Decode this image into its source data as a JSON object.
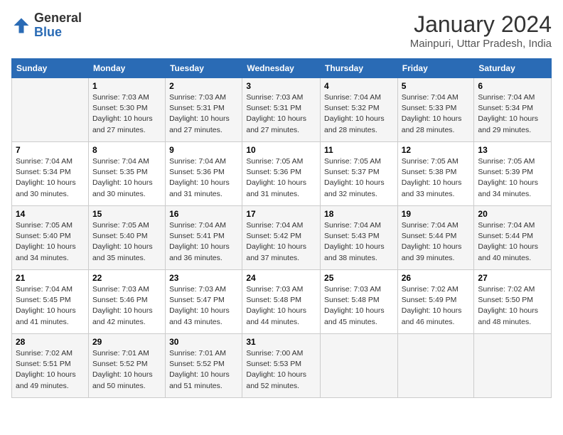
{
  "header": {
    "logo_general": "General",
    "logo_blue": "Blue",
    "month_year": "January 2024",
    "location": "Mainpuri, Uttar Pradesh, India"
  },
  "days_of_week": [
    "Sunday",
    "Monday",
    "Tuesday",
    "Wednesday",
    "Thursday",
    "Friday",
    "Saturday"
  ],
  "weeks": [
    [
      {
        "day": "",
        "info": ""
      },
      {
        "day": "1",
        "info": "Sunrise: 7:03 AM\nSunset: 5:30 PM\nDaylight: 10 hours\nand 27 minutes."
      },
      {
        "day": "2",
        "info": "Sunrise: 7:03 AM\nSunset: 5:31 PM\nDaylight: 10 hours\nand 27 minutes."
      },
      {
        "day": "3",
        "info": "Sunrise: 7:03 AM\nSunset: 5:31 PM\nDaylight: 10 hours\nand 27 minutes."
      },
      {
        "day": "4",
        "info": "Sunrise: 7:04 AM\nSunset: 5:32 PM\nDaylight: 10 hours\nand 28 minutes."
      },
      {
        "day": "5",
        "info": "Sunrise: 7:04 AM\nSunset: 5:33 PM\nDaylight: 10 hours\nand 28 minutes."
      },
      {
        "day": "6",
        "info": "Sunrise: 7:04 AM\nSunset: 5:34 PM\nDaylight: 10 hours\nand 29 minutes."
      }
    ],
    [
      {
        "day": "7",
        "info": "Sunrise: 7:04 AM\nSunset: 5:34 PM\nDaylight: 10 hours\nand 30 minutes."
      },
      {
        "day": "8",
        "info": "Sunrise: 7:04 AM\nSunset: 5:35 PM\nDaylight: 10 hours\nand 30 minutes."
      },
      {
        "day": "9",
        "info": "Sunrise: 7:04 AM\nSunset: 5:36 PM\nDaylight: 10 hours\nand 31 minutes."
      },
      {
        "day": "10",
        "info": "Sunrise: 7:05 AM\nSunset: 5:36 PM\nDaylight: 10 hours\nand 31 minutes."
      },
      {
        "day": "11",
        "info": "Sunrise: 7:05 AM\nSunset: 5:37 PM\nDaylight: 10 hours\nand 32 minutes."
      },
      {
        "day": "12",
        "info": "Sunrise: 7:05 AM\nSunset: 5:38 PM\nDaylight: 10 hours\nand 33 minutes."
      },
      {
        "day": "13",
        "info": "Sunrise: 7:05 AM\nSunset: 5:39 PM\nDaylight: 10 hours\nand 34 minutes."
      }
    ],
    [
      {
        "day": "14",
        "info": "Sunrise: 7:05 AM\nSunset: 5:40 PM\nDaylight: 10 hours\nand 34 minutes."
      },
      {
        "day": "15",
        "info": "Sunrise: 7:05 AM\nSunset: 5:40 PM\nDaylight: 10 hours\nand 35 minutes."
      },
      {
        "day": "16",
        "info": "Sunrise: 7:04 AM\nSunset: 5:41 PM\nDaylight: 10 hours\nand 36 minutes."
      },
      {
        "day": "17",
        "info": "Sunrise: 7:04 AM\nSunset: 5:42 PM\nDaylight: 10 hours\nand 37 minutes."
      },
      {
        "day": "18",
        "info": "Sunrise: 7:04 AM\nSunset: 5:43 PM\nDaylight: 10 hours\nand 38 minutes."
      },
      {
        "day": "19",
        "info": "Sunrise: 7:04 AM\nSunset: 5:44 PM\nDaylight: 10 hours\nand 39 minutes."
      },
      {
        "day": "20",
        "info": "Sunrise: 7:04 AM\nSunset: 5:44 PM\nDaylight: 10 hours\nand 40 minutes."
      }
    ],
    [
      {
        "day": "21",
        "info": "Sunrise: 7:04 AM\nSunset: 5:45 PM\nDaylight: 10 hours\nand 41 minutes."
      },
      {
        "day": "22",
        "info": "Sunrise: 7:03 AM\nSunset: 5:46 PM\nDaylight: 10 hours\nand 42 minutes."
      },
      {
        "day": "23",
        "info": "Sunrise: 7:03 AM\nSunset: 5:47 PM\nDaylight: 10 hours\nand 43 minutes."
      },
      {
        "day": "24",
        "info": "Sunrise: 7:03 AM\nSunset: 5:48 PM\nDaylight: 10 hours\nand 44 minutes."
      },
      {
        "day": "25",
        "info": "Sunrise: 7:03 AM\nSunset: 5:48 PM\nDaylight: 10 hours\nand 45 minutes."
      },
      {
        "day": "26",
        "info": "Sunrise: 7:02 AM\nSunset: 5:49 PM\nDaylight: 10 hours\nand 46 minutes."
      },
      {
        "day": "27",
        "info": "Sunrise: 7:02 AM\nSunset: 5:50 PM\nDaylight: 10 hours\nand 48 minutes."
      }
    ],
    [
      {
        "day": "28",
        "info": "Sunrise: 7:02 AM\nSunset: 5:51 PM\nDaylight: 10 hours\nand 49 minutes."
      },
      {
        "day": "29",
        "info": "Sunrise: 7:01 AM\nSunset: 5:52 PM\nDaylight: 10 hours\nand 50 minutes."
      },
      {
        "day": "30",
        "info": "Sunrise: 7:01 AM\nSunset: 5:52 PM\nDaylight: 10 hours\nand 51 minutes."
      },
      {
        "day": "31",
        "info": "Sunrise: 7:00 AM\nSunset: 5:53 PM\nDaylight: 10 hours\nand 52 minutes."
      },
      {
        "day": "",
        "info": ""
      },
      {
        "day": "",
        "info": ""
      },
      {
        "day": "",
        "info": ""
      }
    ]
  ]
}
